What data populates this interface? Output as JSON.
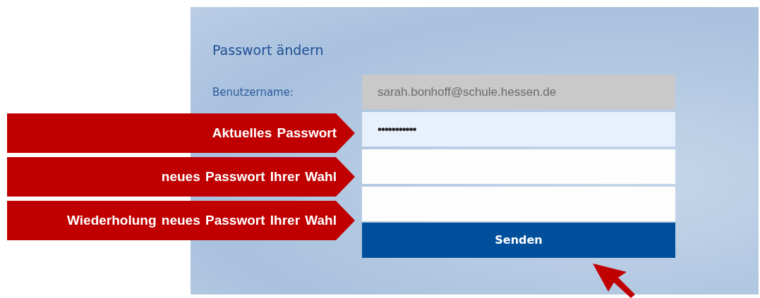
{
  "form": {
    "title": "Passwort ändern",
    "username_label": "Benutzername:",
    "username": {
      "value": "sarah.bonhoff@schule.hessen.de",
      "disabled": true
    },
    "fields": [
      {
        "value": "•••••••••••",
        "focused": true
      },
      {
        "focused": false
      },
      {
        "focused": false
      }
    ],
    "submit": "Senden"
  },
  "callouts": [
    "Aktuelles Passwort",
    "neues Passwort Ihrer Wahl",
    "Wiederholung neues Passwort Ihrer Wahl"
  ]
}
